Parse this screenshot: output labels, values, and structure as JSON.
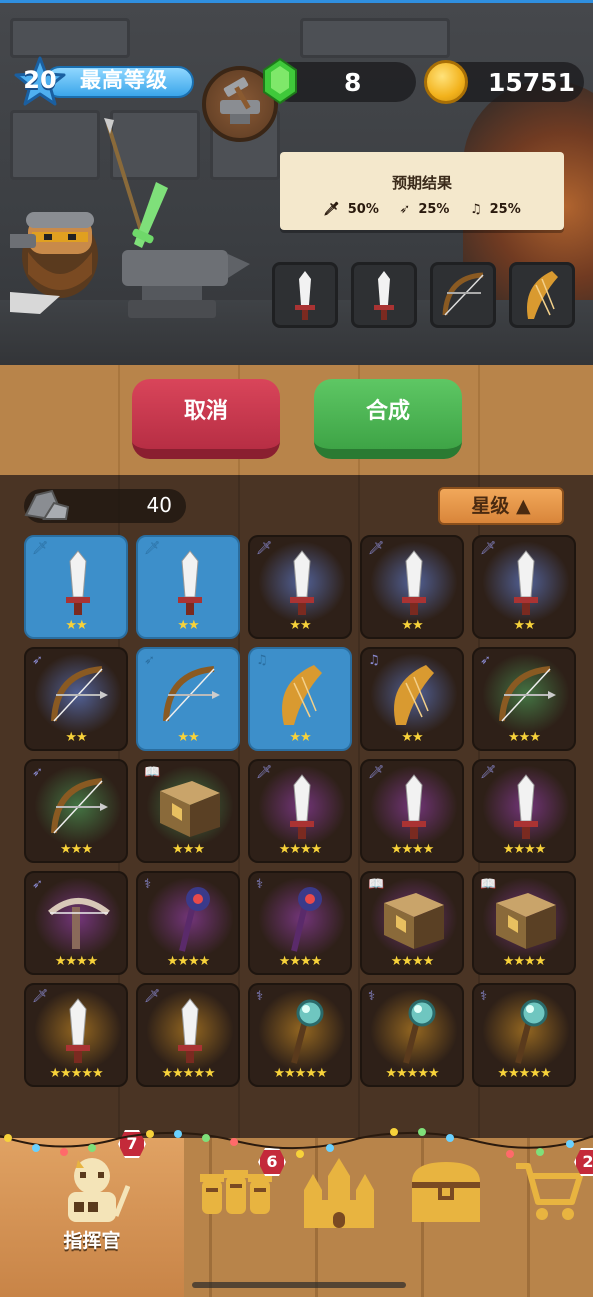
{
  "header": {
    "level_value": "20",
    "level_label": "最高等级",
    "gems": "8",
    "gold": "15751"
  },
  "result_card": {
    "title": "预期结果",
    "odds": [
      {
        "icon": "sword-class-icon",
        "value": "50%"
      },
      {
        "icon": "bow-class-icon",
        "value": "25%"
      },
      {
        "icon": "music-class-icon",
        "value": "25%"
      }
    ]
  },
  "materials": [
    "sword",
    "sword",
    "bow",
    "harp"
  ],
  "buttons": {
    "cancel": "取消",
    "compose": "合成"
  },
  "inventory": {
    "ore_count": "40",
    "sort_label": "星级 ▲",
    "items": [
      {
        "type": "sword",
        "stars": 2,
        "selected": true,
        "glow": "none"
      },
      {
        "type": "sword",
        "stars": 2,
        "selected": true,
        "glow": "none"
      },
      {
        "type": "sword",
        "stars": 2,
        "selected": false,
        "glow": "blue"
      },
      {
        "type": "sword",
        "stars": 2,
        "selected": false,
        "glow": "blue"
      },
      {
        "type": "sword",
        "stars": 2,
        "selected": false,
        "glow": "blue"
      },
      {
        "type": "bow",
        "stars": 2,
        "selected": false,
        "glow": "blue"
      },
      {
        "type": "bow",
        "stars": 2,
        "selected": true,
        "glow": "none"
      },
      {
        "type": "harp",
        "stars": 2,
        "selected": true,
        "glow": "none"
      },
      {
        "type": "harp",
        "stars": 2,
        "selected": false,
        "glow": "blue"
      },
      {
        "type": "bow",
        "stars": 3,
        "selected": false,
        "glow": "green"
      },
      {
        "type": "bow",
        "stars": 3,
        "selected": false,
        "glow": "green"
      },
      {
        "type": "book",
        "stars": 3,
        "selected": false,
        "glow": "green"
      },
      {
        "type": "sword",
        "stars": 4,
        "selected": false,
        "glow": "purple"
      },
      {
        "type": "sword",
        "stars": 4,
        "selected": false,
        "glow": "purple"
      },
      {
        "type": "sword",
        "stars": 4,
        "selected": false,
        "glow": "purple"
      },
      {
        "type": "crossbow",
        "stars": 4,
        "selected": false,
        "glow": "purple"
      },
      {
        "type": "staff",
        "stars": 4,
        "selected": false,
        "glow": "purple"
      },
      {
        "type": "staff",
        "stars": 4,
        "selected": false,
        "glow": "purple"
      },
      {
        "type": "book",
        "stars": 4,
        "selected": false,
        "glow": "purple"
      },
      {
        "type": "book",
        "stars": 4,
        "selected": false,
        "glow": "purple"
      },
      {
        "type": "sword",
        "stars": 5,
        "selected": false,
        "glow": "gold"
      },
      {
        "type": "sword",
        "stars": 5,
        "selected": false,
        "glow": "gold"
      },
      {
        "type": "orb-staff",
        "stars": 5,
        "selected": false,
        "glow": "gold"
      },
      {
        "type": "orb-staff",
        "stars": 5,
        "selected": false,
        "glow": "gold"
      },
      {
        "type": "orb-staff",
        "stars": 5,
        "selected": false,
        "glow": "gold"
      }
    ]
  },
  "nav": {
    "commander_label": "指挥官",
    "commander_badge": "7",
    "troops_badge": "6",
    "shop_badge": "2"
  },
  "colors": {
    "gem": "#3fc93a",
    "gold": "#f2b21c",
    "cancel": "#d9455a",
    "compose": "#5ec764",
    "selected_cell": "#3d8fca",
    "star": "#f7d23a"
  }
}
